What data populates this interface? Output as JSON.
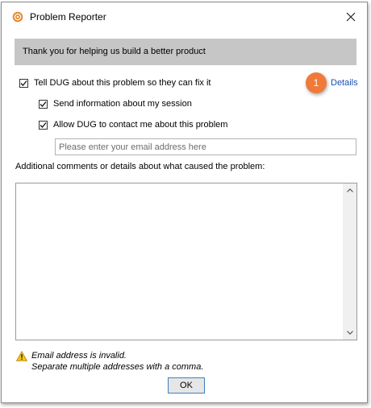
{
  "window": {
    "title": "Problem Reporter",
    "app_icon": "target-icon",
    "close_icon": "close-icon"
  },
  "banner": {
    "text": "Thank you for helping us build a better product"
  },
  "options": {
    "tell_dug": {
      "label": "Tell DUG about this problem so they can fix it",
      "checked": true
    },
    "send_session": {
      "label": "Send information about my session",
      "checked": true
    },
    "allow_contact": {
      "label": "Allow DUG to contact me about this problem",
      "checked": true
    }
  },
  "details_link": "Details",
  "callout_number": "1",
  "email": {
    "placeholder": "Please enter your email address here",
    "value": ""
  },
  "comments": {
    "label": "Additional comments or details about what caused the problem:",
    "value": ""
  },
  "warning": {
    "icon": "warning-icon",
    "line1": "Email address is invalid.",
    "line2": "Separate multiple addresses with a comma."
  },
  "ok_button": "OK",
  "colors": {
    "banner": "#c6c6c6",
    "link": "#1a4fb5",
    "callout": "#f07a3a",
    "app_icon": "#e8862a"
  }
}
